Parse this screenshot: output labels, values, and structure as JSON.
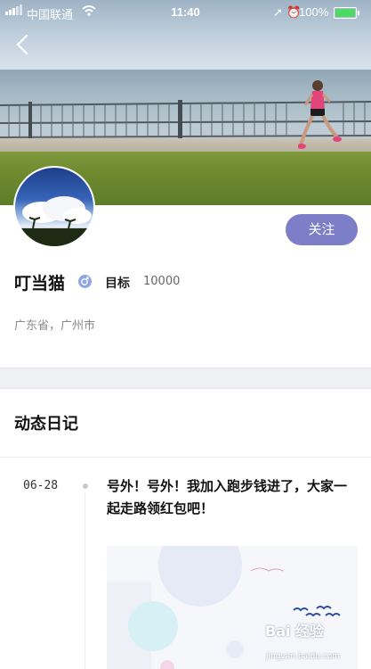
{
  "status_bar": {
    "carrier": "中国联通",
    "time": "11:40",
    "battery_percent": "100%"
  },
  "profile": {
    "name": "叮当猫",
    "goal_label": "目标",
    "goal_value": "10000",
    "location": "广东省，广州市",
    "follow_label": "关注"
  },
  "diary": {
    "section_title": "动态日记",
    "entries": [
      {
        "date": "06-28",
        "text": "号外！号外！我加入跑步钱进了，大家一起走路领红包吧！"
      }
    ]
  },
  "watermark": {
    "brand": "Bai 经验",
    "sub": "jingyan.baidu.com"
  },
  "colors": {
    "accent": "#7c7ec7",
    "gender_icon": "#8fa6e6",
    "battery": "#4cd964"
  },
  "icons": [
    "signal-icon",
    "wifi-icon",
    "location-icon",
    "alarm-icon",
    "battery-icon",
    "back-arrow-icon",
    "gender-icon"
  ]
}
